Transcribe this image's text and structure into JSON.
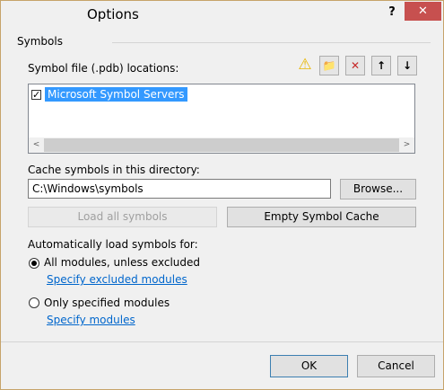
{
  "window": {
    "title": "Options",
    "help": "?",
    "close": "✕"
  },
  "group": {
    "title": "Symbols"
  },
  "locations": {
    "label": "Symbol file (.pdb) locations:",
    "items": [
      {
        "label": "Microsoft Symbol Servers",
        "checked": true
      }
    ],
    "toolbar": {
      "warning": "⚠",
      "add": "📁",
      "remove": "✕",
      "up": "↑",
      "down": "↓"
    },
    "scroll_left": "<",
    "scroll_right": ">"
  },
  "cache": {
    "label": "Cache symbols in this directory:",
    "value": "C:\\Windows\\symbols",
    "browse": "Browse..."
  },
  "actions": {
    "load_all": "Load all symbols",
    "empty_cache": "Empty Symbol Cache"
  },
  "autoload": {
    "label": "Automatically load symbols for:",
    "option1": "All modules, unless excluded",
    "option1_link": "Specify excluded modules",
    "option2": "Only specified modules",
    "option2_link": "Specify modules",
    "selected": "option1"
  },
  "footer": {
    "ok": "OK",
    "cancel": "Cancel"
  }
}
